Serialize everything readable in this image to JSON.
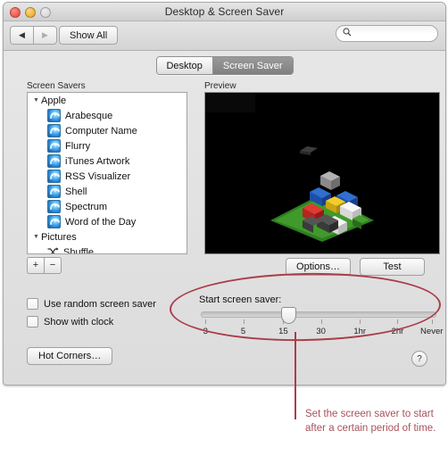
{
  "window": {
    "title": "Desktop & Screen Saver",
    "traffic_lights": [
      "close",
      "minimize",
      "zoom"
    ]
  },
  "toolbar": {
    "back_label": "◀",
    "forward_label": "▶",
    "show_all_label": "Show All",
    "search_placeholder": "",
    "search_value": "",
    "search_icon": "search-icon"
  },
  "tabs": [
    {
      "label": "Desktop",
      "active": false
    },
    {
      "label": "Screen Saver",
      "active": true
    }
  ],
  "panel": {
    "screen_savers_label": "Screen Savers",
    "preview_label": "Preview",
    "groups": [
      {
        "name": "Apple",
        "expanded": true,
        "items": [
          {
            "label": "Arabesque",
            "icon": "screensaver-icon"
          },
          {
            "label": "Computer Name",
            "icon": "screensaver-icon"
          },
          {
            "label": "Flurry",
            "icon": "screensaver-icon"
          },
          {
            "label": "iTunes Artwork",
            "icon": "screensaver-icon"
          },
          {
            "label": "RSS Visualizer",
            "icon": "screensaver-icon"
          },
          {
            "label": "Shell",
            "icon": "screensaver-icon"
          },
          {
            "label": "Spectrum",
            "icon": "screensaver-icon"
          },
          {
            "label": "Word of the Day",
            "icon": "screensaver-icon"
          }
        ]
      },
      {
        "name": "Pictures",
        "expanded": true,
        "items": [
          {
            "label": "Shuffle",
            "icon": "shuffle-icon"
          }
        ]
      }
    ],
    "add_button_label": "+",
    "remove_button_label": "−",
    "options_button_label": "Options…",
    "test_button_label": "Test",
    "checkboxes": [
      {
        "label": "Use random screen saver",
        "checked": false
      },
      {
        "label": "Show with clock",
        "checked": false
      }
    ],
    "slider": {
      "title": "Start screen saver:",
      "ticks": [
        "3",
        "5",
        "15",
        "30",
        "1hr",
        "2hr",
        "Never"
      ],
      "value_position_percent": 36.5
    },
    "hot_corners_button_label": "Hot Corners…",
    "help_button_label": "?"
  },
  "annotation": {
    "text": "Set the screen saver to start after a certain period of time.",
    "color": "#a9515a"
  }
}
